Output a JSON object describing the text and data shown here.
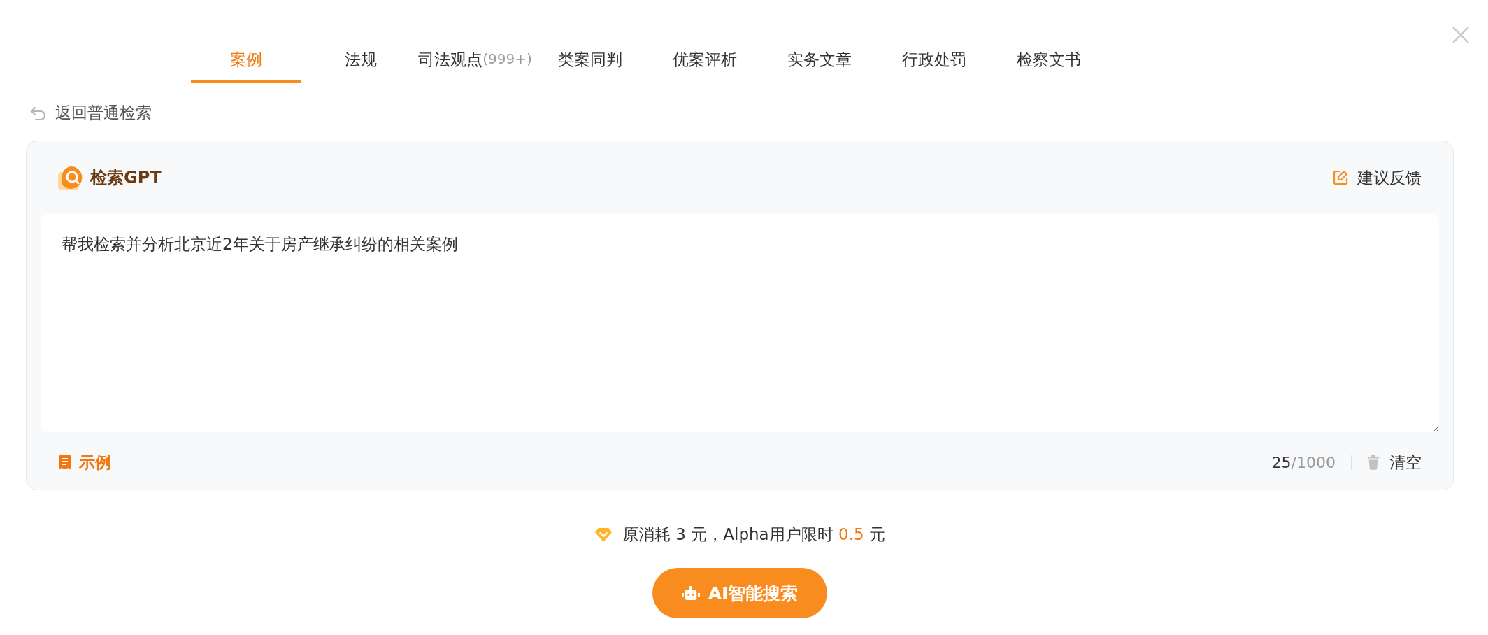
{
  "tabs": [
    {
      "label": "案例",
      "selected": true
    },
    {
      "label": "法规",
      "selected": false
    },
    {
      "label": "司法观点",
      "count": "(999+)",
      "selected": false
    },
    {
      "label": "类案同判",
      "selected": false
    },
    {
      "label": "优案评析",
      "selected": false
    },
    {
      "label": "实务文章",
      "selected": false
    },
    {
      "label": "行政处罚",
      "selected": false
    },
    {
      "label": "检察文书",
      "selected": false
    }
  ],
  "back_link": "返回普通检索",
  "card": {
    "logo_text": "检索GPT",
    "feedback": "建议反馈",
    "query": "帮我检索并分析北京近2年关于房产继承纠纷的相关案例",
    "example": "示例",
    "char_count": "25",
    "char_limit": "/1000",
    "clear": "清空"
  },
  "cost": {
    "original": "原消耗 3 元，Alpha用户限时",
    "price": "0.5",
    "unit": "元"
  },
  "search_button": "AI智能搜索"
}
